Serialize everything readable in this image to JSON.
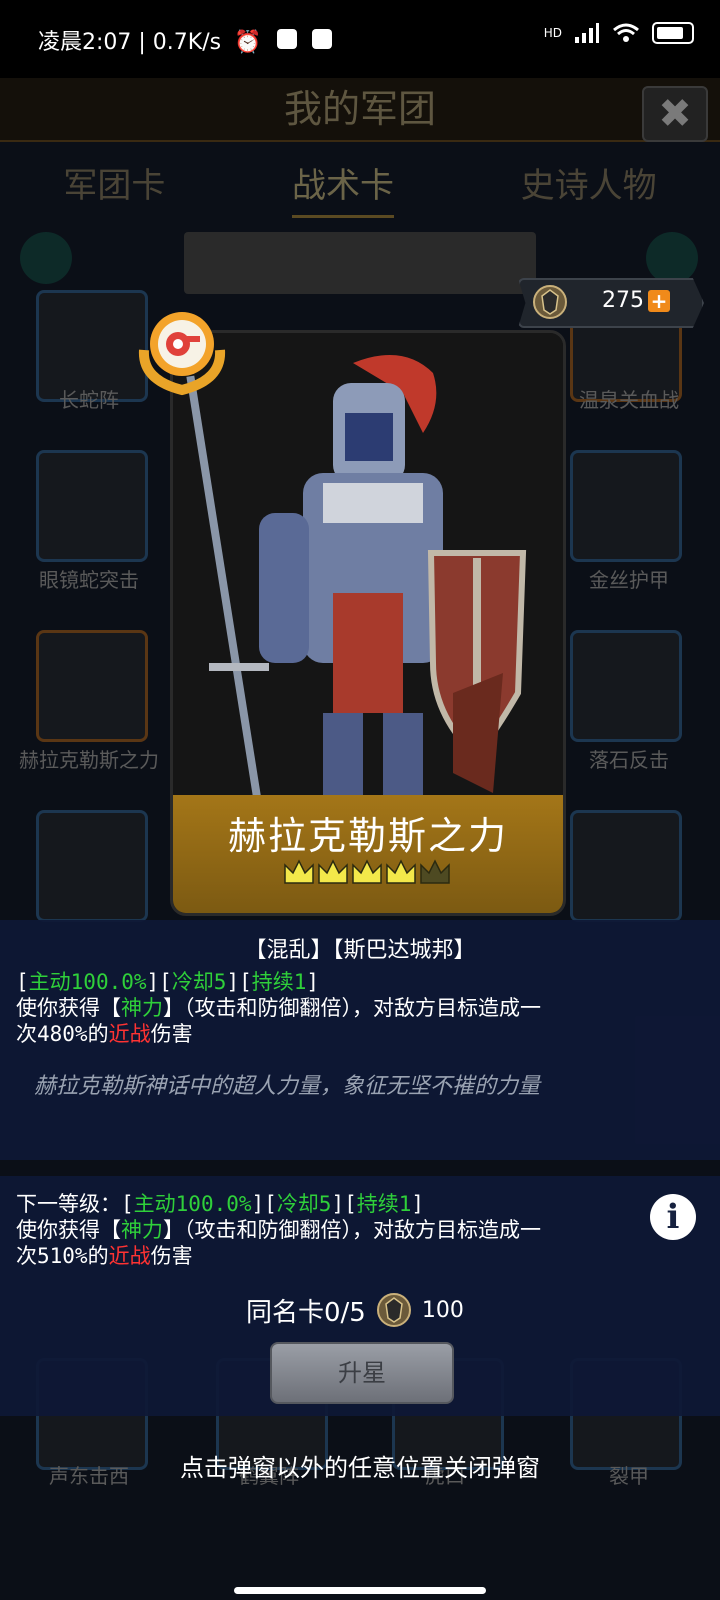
{
  "status_bar": {
    "time": "凌晨2:07 | 0.7K/s",
    "network": "HD"
  },
  "background": {
    "title": "我的军团",
    "tabs": [
      "军团卡",
      "战术卡",
      "史诗人物"
    ],
    "active_tab": "战术卡",
    "card_labels": [
      "长蛇阵",
      "温泉关血战",
      "眼镜蛇突击",
      "金丝护甲",
      "赫拉克勒斯之力",
      "落石反击",
      "声东击西",
      "鹤翼阵",
      "虎口",
      "裂甲"
    ]
  },
  "cost_badge": {
    "value": "275"
  },
  "card": {
    "name": "赫拉克勒斯之力",
    "stars_filled": 4,
    "stars_total": 5
  },
  "current": {
    "tags": "【混乱】【斯巴达城邦】",
    "line1": {
      "b1": "[",
      "active": "主动100.0%",
      "b2": "][",
      "cooldown": "冷却5",
      "b3": "][",
      "duration": "持续1",
      "b4": "]"
    },
    "line2": {
      "pre": "使你获得【",
      "buff": "神力",
      "post": "】（攻击和防御翻倍），对敌方目标造成一"
    },
    "line3": {
      "pre": "次480%的",
      "dmg": "近战",
      "post": "伤害"
    },
    "lore": "赫拉克勒斯神话中的超人力量，象征无坚不摧的力量"
  },
  "next": {
    "line1": {
      "pre": "下一等级：[",
      "active": "主动100.0%",
      "b2": "][",
      "cooldown": "冷却5",
      "b3": "][",
      "duration": "持续1",
      "b4": "]"
    },
    "line2": {
      "pre": "使你获得【",
      "buff": "神力",
      "post": "】（攻击和防御翻倍），对敌方目标造成一"
    },
    "line3": {
      "pre": "次510%的",
      "dmg": "近战",
      "post": "伤害"
    },
    "dup_label": "同名卡0/5",
    "dup_cost": "100",
    "upgrade_label": "升星",
    "info_label": "i"
  },
  "hint": "点击弹窗以外的任意位置关闭弹窗",
  "colors": {
    "green": "#2fd03a",
    "red": "#ff3333",
    "panel": "#0e1836",
    "gold": "#a47618"
  }
}
